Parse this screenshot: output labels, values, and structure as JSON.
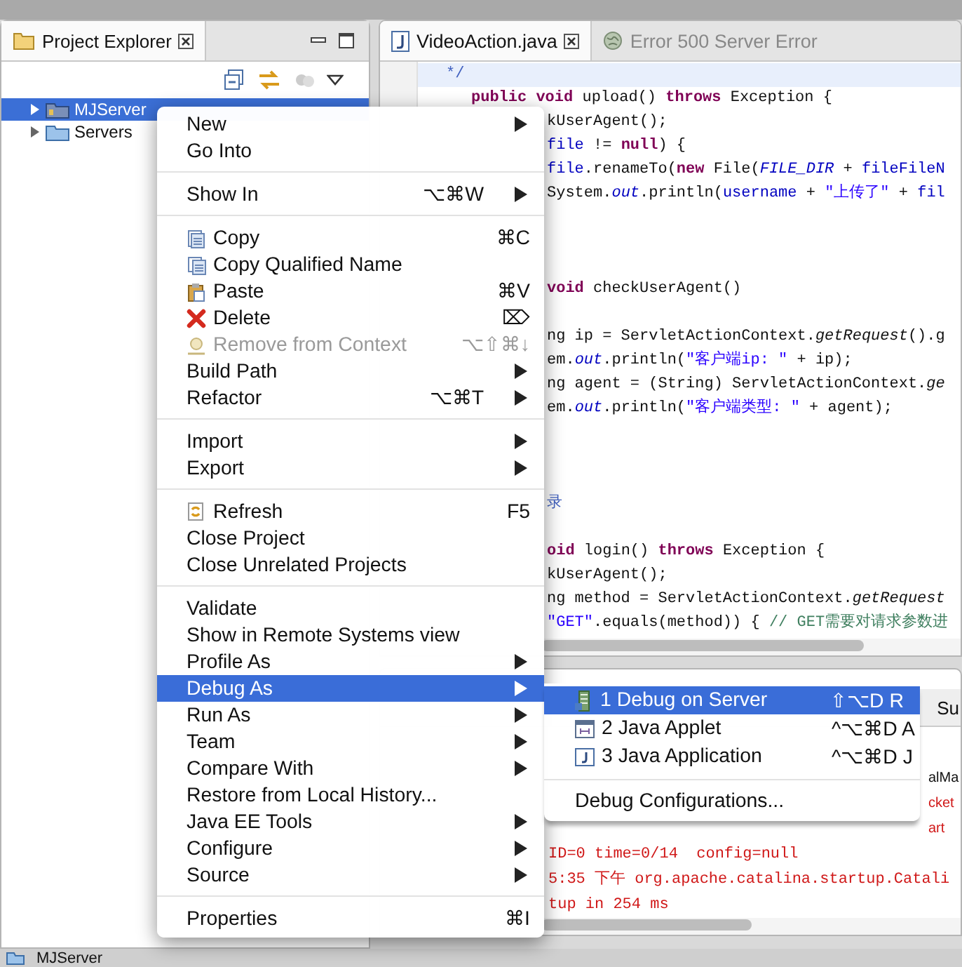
{
  "explorer": {
    "tab": {
      "label": "Project Explorer",
      "selected": true
    },
    "tree": [
      {
        "label": "MJServer",
        "kind": "project",
        "selected": true,
        "expanded": false
      },
      {
        "label": "Servers",
        "kind": "folder",
        "selected": false,
        "expanded": false
      }
    ]
  },
  "editor": {
    "tabs": [
      {
        "label": "VideoAction.java",
        "kind": "java",
        "selected": true
      },
      {
        "label": "Error 500 Server Error",
        "kind": "web",
        "selected": false
      }
    ],
    "lines": [
      {
        "kind": "indent1",
        "tokens": [
          {
            "t": "*/",
            "kind": "doc"
          }
        ]
      },
      {
        "kind": "indent2",
        "tokens": [
          {
            "t": "public void",
            "kind": "kw"
          },
          {
            "t": " upload() ",
            "kind": "plain"
          },
          {
            "t": "throws",
            "kind": "kw"
          },
          {
            "t": " Exception {",
            "kind": "plain"
          }
        ]
      },
      {
        "kind": "clipped",
        "tokens": [
          {
            "t": "kUserAgent();",
            "kind": "plain"
          }
        ]
      },
      {
        "kind": "clipped",
        "tokens": [
          {
            "t": "file",
            "kind": "field"
          },
          {
            "t": " != ",
            "kind": "plain"
          },
          {
            "t": "null",
            "kind": "kw"
          },
          {
            "t": ") {",
            "kind": "plain"
          }
        ]
      },
      {
        "kind": "clipped",
        "tokens": [
          {
            "t": "file",
            "kind": "field"
          },
          {
            "t": ".renameTo(",
            "kind": "plain"
          },
          {
            "t": "new",
            "kind": "kw"
          },
          {
            "t": " File(",
            "kind": "plain"
          },
          {
            "t": "FILE_DIR",
            "kind": "static"
          },
          {
            "t": " + ",
            "kind": "plain"
          },
          {
            "t": "fileFileN",
            "kind": "field"
          }
        ]
      },
      {
        "kind": "clipped",
        "tokens": [
          {
            "t": "System.",
            "kind": "plain"
          },
          {
            "t": "out",
            "kind": "static"
          },
          {
            "t": ".println(",
            "kind": "plain"
          },
          {
            "t": "username",
            "kind": "field"
          },
          {
            "t": " + ",
            "kind": "plain"
          },
          {
            "t": "\"上传了\"",
            "kind": "str"
          },
          {
            "t": " + ",
            "kind": "plain"
          },
          {
            "t": "fil",
            "kind": "field"
          }
        ]
      },
      {
        "kind": "blank"
      },
      {
        "kind": "blank"
      },
      {
        "kind": "blank"
      },
      {
        "kind": "clipped",
        "tokens": [
          {
            "t": "void",
            "kind": "kw"
          },
          {
            "t": " checkUserAgent()",
            "kind": "plain"
          }
        ]
      },
      {
        "kind": "blank"
      },
      {
        "kind": "clipped",
        "tokens": [
          {
            "t": "ng ip = ServletActionContext.",
            "kind": "plain"
          },
          {
            "t": "getRequest",
            "kind": "italic"
          },
          {
            "t": "().g",
            "kind": "plain"
          }
        ]
      },
      {
        "kind": "clipped",
        "tokens": [
          {
            "t": "em.",
            "kind": "plain"
          },
          {
            "t": "out",
            "kind": "static"
          },
          {
            "t": ".println(",
            "kind": "plain"
          },
          {
            "t": "\"客户端ip: \"",
            "kind": "str"
          },
          {
            "t": " + ip);",
            "kind": "plain"
          }
        ]
      },
      {
        "kind": "clipped",
        "tokens": [
          {
            "t": "ng agent = (String) ServletActionContext.",
            "kind": "plain"
          },
          {
            "t": "ge",
            "kind": "italic"
          }
        ]
      },
      {
        "kind": "clipped",
        "tokens": [
          {
            "t": "em.",
            "kind": "plain"
          },
          {
            "t": "out",
            "kind": "static"
          },
          {
            "t": ".println(",
            "kind": "plain"
          },
          {
            "t": "\"客户端类型: \"",
            "kind": "str"
          },
          {
            "t": " + agent);",
            "kind": "plain"
          }
        ]
      },
      {
        "kind": "blank"
      },
      {
        "kind": "blank"
      },
      {
        "kind": "blank"
      },
      {
        "kind": "clipped",
        "tokens": [
          {
            "t": "录",
            "kind": "doc"
          }
        ]
      },
      {
        "kind": "blank"
      },
      {
        "kind": "clipped",
        "tokens": [
          {
            "t": "oid",
            "kind": "kw"
          },
          {
            "t": " login() ",
            "kind": "plain"
          },
          {
            "t": "throws",
            "kind": "kw"
          },
          {
            "t": " Exception {",
            "kind": "plain"
          }
        ]
      },
      {
        "kind": "clipped",
        "tokens": [
          {
            "t": "kUserAgent();",
            "kind": "plain"
          }
        ]
      },
      {
        "kind": "clipped",
        "tokens": [
          {
            "t": "ng method = ServletActionContext.",
            "kind": "plain"
          },
          {
            "t": "getRequest",
            "kind": "italic"
          }
        ]
      },
      {
        "kind": "clipped",
        "tokens": [
          {
            "t": "\"GET\"",
            "kind": "str"
          },
          {
            "t": ".equals(method)) { ",
            "kind": "plain"
          },
          {
            "t": "// GET需要对请求参数进",
            "kind": "comment"
          }
        ]
      }
    ]
  },
  "console": {
    "tab": {
      "label": "Su"
    },
    "lines": [
      {
        "kind": "edge",
        "error": false,
        "text": "alMa"
      },
      {
        "kind": "edge",
        "error": true,
        "text": "cket"
      },
      {
        "kind": "edge",
        "error": true,
        "text": "art"
      },
      {
        "kind": "line",
        "error": true,
        "text": "ID=0 time=0/14  config=null"
      },
      {
        "kind": "line",
        "error": true,
        "text": "5:35 下午 org.apache.catalina.startup.Catali"
      },
      {
        "kind": "line",
        "error": true,
        "text": "tup in 254 ms"
      }
    ]
  },
  "menu": {
    "items": [
      {
        "kind": "plain",
        "label": "New",
        "submenu": true,
        "disabled": false,
        "selected": false
      },
      {
        "kind": "plain",
        "label": "Go Into",
        "submenu": false,
        "disabled": false,
        "selected": false
      },
      {
        "kind": "separator"
      },
      {
        "kind": "plain",
        "label": "Show In",
        "shortcut": "⌥⌘W",
        "submenu": true,
        "disabled": false,
        "selected": false
      },
      {
        "kind": "separator"
      },
      {
        "kind": "copy",
        "label": "Copy",
        "shortcut": "⌘C",
        "submenu": false,
        "disabled": false,
        "selected": false
      },
      {
        "kind": "copy-qualified",
        "label": "Copy Qualified Name",
        "submenu": false,
        "disabled": false,
        "selected": false
      },
      {
        "kind": "paste",
        "label": "Paste",
        "shortcut": "⌘V",
        "submenu": false,
        "disabled": false,
        "selected": false
      },
      {
        "kind": "delete",
        "label": "Delete",
        "shortcut": "⌦",
        "submenu": false,
        "disabled": false,
        "selected": false
      },
      {
        "kind": "remove",
        "label": "Remove from Context",
        "shortcut": "⌥⇧⌘↓",
        "submenu": false,
        "disabled": true,
        "selected": false
      },
      {
        "kind": "plain",
        "label": "Build Path",
        "submenu": true,
        "disabled": false,
        "selected": false
      },
      {
        "kind": "plain",
        "label": "Refactor",
        "shortcut": "⌥⌘T",
        "submenu": true,
        "disabled": false,
        "selected": false
      },
      {
        "kind": "separator"
      },
      {
        "kind": "plain",
        "label": "Import",
        "submenu": true,
        "disabled": false,
        "selected": false
      },
      {
        "kind": "plain",
        "label": "Export",
        "submenu": true,
        "disabled": false,
        "selected": false
      },
      {
        "kind": "separator"
      },
      {
        "kind": "refresh",
        "label": "Refresh",
        "shortcut": "F5",
        "submenu": false,
        "disabled": false,
        "selected": false
      },
      {
        "kind": "plain",
        "label": "Close Project",
        "submenu": false,
        "disabled": false,
        "selected": false
      },
      {
        "kind": "plain",
        "label": "Close Unrelated Projects",
        "submenu": false,
        "disabled": false,
        "selected": false
      },
      {
        "kind": "separator"
      },
      {
        "kind": "plain",
        "label": "Validate",
        "submenu": false,
        "disabled": false,
        "selected": false
      },
      {
        "kind": "plain",
        "label": "Show in Remote Systems view",
        "submenu": false,
        "disabled": false,
        "selected": false
      },
      {
        "kind": "plain",
        "label": "Profile As",
        "submenu": true,
        "disabled": false,
        "selected": false
      },
      {
        "kind": "plain",
        "label": "Debug As",
        "submenu": true,
        "disabled": false,
        "selected": true
      },
      {
        "kind": "plain",
        "label": "Run As",
        "submenu": true,
        "disabled": false,
        "selected": false
      },
      {
        "kind": "plain",
        "label": "Team",
        "submenu": true,
        "disabled": false,
        "selected": false
      },
      {
        "kind": "plain",
        "label": "Compare With",
        "submenu": true,
        "disabled": false,
        "selected": false
      },
      {
        "kind": "plain",
        "label": "Restore from Local History...",
        "submenu": false,
        "disabled": false,
        "selected": false
      },
      {
        "kind": "plain",
        "label": "Java EE Tools",
        "submenu": true,
        "disabled": false,
        "selected": false
      },
      {
        "kind": "plain",
        "label": "Configure",
        "submenu": true,
        "disabled": false,
        "selected": false
      },
      {
        "kind": "plain",
        "label": "Source",
        "submenu": true,
        "disabled": false,
        "selected": false
      },
      {
        "kind": "separator"
      },
      {
        "kind": "plain",
        "label": "Properties",
        "shortcut": "⌘I",
        "submenu": false,
        "disabled": false,
        "selected": false
      }
    ]
  },
  "submenu": {
    "items": [
      {
        "kind": "server",
        "label": "1 Debug on Server",
        "shortcut": "⇧⌥D R",
        "selected": true
      },
      {
        "kind": "applet",
        "label": "2 Java Applet",
        "shortcut": "^⌥⌘D A",
        "selected": false
      },
      {
        "kind": "application",
        "label": "3 Java Application",
        "shortcut": "^⌥⌘D J",
        "selected": false
      },
      {
        "kind": "separator"
      },
      {
        "kind": "plain",
        "label": "Debug Configurations...",
        "selected": false
      }
    ]
  },
  "status_bar": {
    "label": "MJServer"
  }
}
